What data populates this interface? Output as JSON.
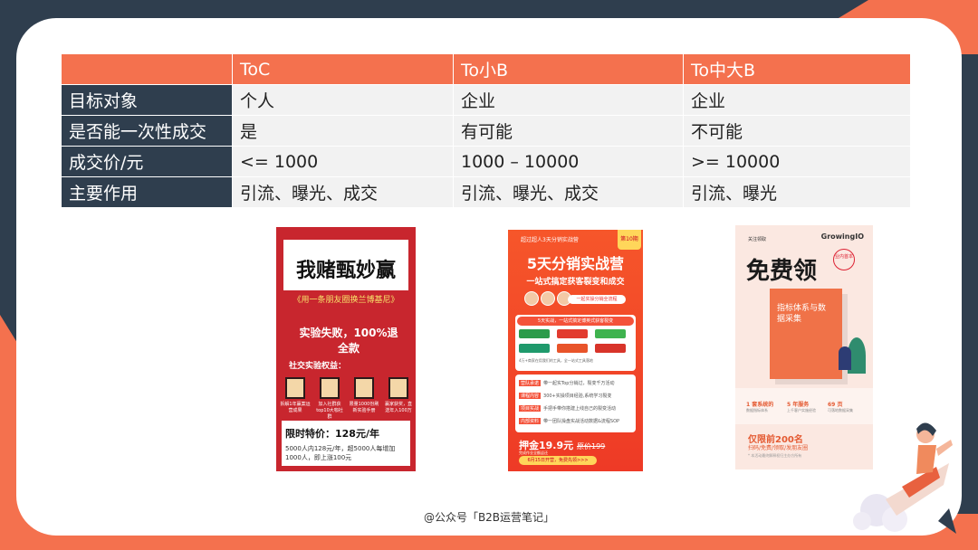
{
  "table": {
    "headers": [
      "",
      "ToC",
      "To小B",
      "To中大B"
    ],
    "rows": [
      {
        "label": "目标对象",
        "cells": [
          "个人",
          "企业",
          "企业"
        ]
      },
      {
        "label": "是否能一次性成交",
        "cells": [
          "是",
          "有可能",
          "不可能"
        ]
      },
      {
        "label": "成交价/元",
        "cells": [
          "<= 1000",
          "1000 – 10000",
          ">= 10000"
        ]
      },
      {
        "label": "主要作用",
        "cells": [
          "引流、曝光、成交",
          "引流、曝光、成交",
          "引流、曝光"
        ]
      }
    ]
  },
  "poster1": {
    "title": "我赌甄妙赢",
    "subtitle": "《用一条朋友圈换兰博基尼》",
    "guarantee": "实验失败，100%退全款",
    "benefits_title": "社交实验权益：",
    "perks": [
      "拆解1年赢案运营成果",
      "加入社群获top10大咖社群",
      "限量1000份刷新实验手册",
      "赢家获奖，直送年入100万"
    ],
    "price": "限时特价：128元/年",
    "note": "5000人内128元/年，超5000人每增加1000人，即上涨100元"
  },
  "poster2": {
    "top": "超过超人3天分销实战营",
    "badge": "第10期",
    "title": "5天分销实战营",
    "subtitle": "一站式搞定获客裂变和成交",
    "pill": "一起实操分销全流程",
    "logos_head": "5天实战，一站式搞定博英式获客裂变",
    "logos_note": "4万+商家在用我们的工具，全一站式工具落地",
    "rows": [
      {
        "tag": "营队承诺",
        "text": "带一起实Top分销过，裂变千万活动"
      },
      {
        "tag": "课程内容",
        "text": "300+实操项目经验,系统学习裂变"
      },
      {
        "tag": "项目实战",
        "text": "手把手带你搭建上线自己的裂变活动"
      },
      {
        "tag": "内部资料",
        "text": "带一团队操盘实战活动数据&流程SOP"
      }
    ],
    "price": "押金19.9元",
    "orig_price": "原价199",
    "price_note": "完成作业全额返还",
    "button": "6月15日开营，免费先领>>>"
  },
  "poster3": {
    "brand": "GrowingIO",
    "small": "关注领取",
    "title": "免费领",
    "stamp": "业内首本",
    "book": "指标体系与数据采集",
    "stats": [
      {
        "value": "1 套系统的",
        "desc": "数据指标体系"
      },
      {
        "value": "5 年服务",
        "desc": "上千客户实施经验"
      },
      {
        "value": "69 页",
        "desc": "可落地数据采集"
      }
    ],
    "limit": "仅限前200名",
    "limit2": "扫码/免费/领取/发朋友圈",
    "limit3": "* 本活动最终解释权归主办方所有"
  },
  "credit": "@公众号「B2B运营笔记」"
}
